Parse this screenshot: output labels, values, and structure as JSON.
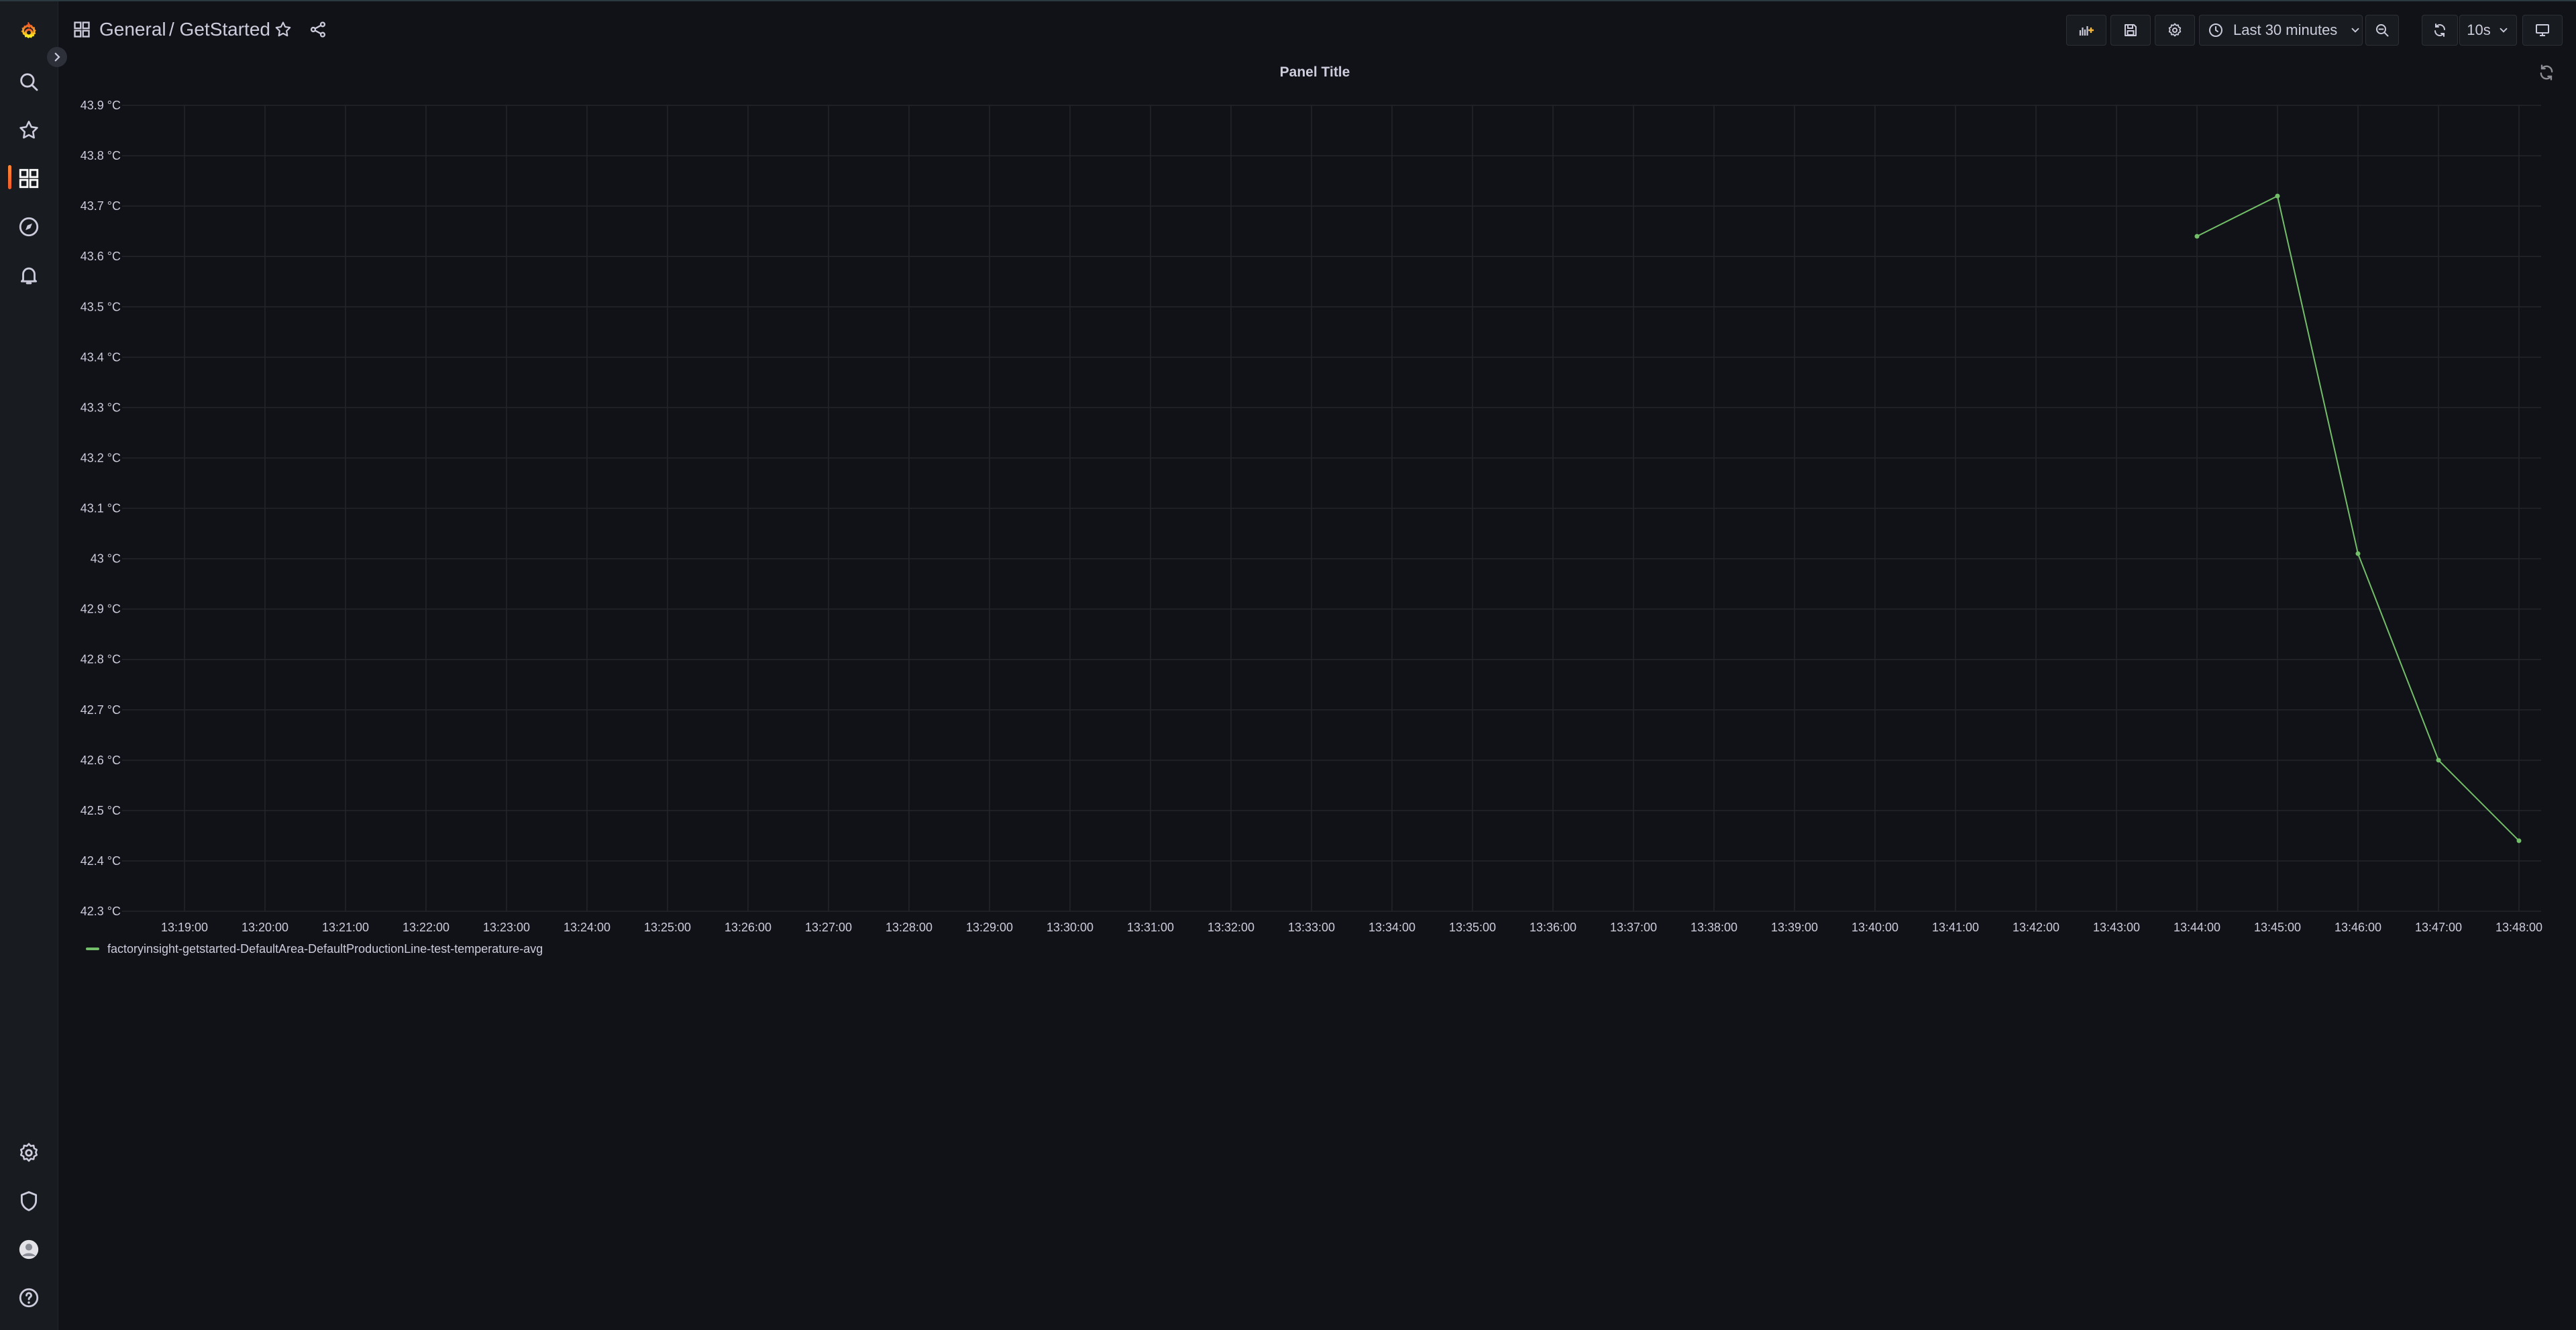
{
  "breadcrumb": {
    "folder": "General",
    "dashboard": "/ GetStarted"
  },
  "toolbar": {
    "time_range": "Last 30 minutes",
    "refresh_interval": "10s"
  },
  "panel": {
    "title": "Panel Title"
  },
  "colors": {
    "series": "#73bf69",
    "accent": "#f05a28",
    "background": "#111217"
  },
  "chart_data": {
    "type": "line",
    "title": "Panel Title",
    "grid": true,
    "legend": "bottom-left",
    "ylim": [
      42.3,
      43.9
    ],
    "y_unit": "°C",
    "y_ticks": [
      "43.9 °C",
      "43.8 °C",
      "43.7 °C",
      "43.6 °C",
      "43.5 °C",
      "43.4 °C",
      "43.3 °C",
      "43.2 °C",
      "43.1 °C",
      "43 °C",
      "42.9 °C",
      "42.8 °C",
      "42.7 °C",
      "42.6 °C",
      "42.5 °C",
      "42.4 °C",
      "42.3 °C"
    ],
    "x_ticks": [
      "13:19:00",
      "13:20:00",
      "13:21:00",
      "13:22:00",
      "13:23:00",
      "13:24:00",
      "13:25:00",
      "13:26:00",
      "13:27:00",
      "13:28:00",
      "13:29:00",
      "13:30:00",
      "13:31:00",
      "13:32:00",
      "13:33:00",
      "13:34:00",
      "13:35:00",
      "13:36:00",
      "13:37:00",
      "13:38:00",
      "13:39:00",
      "13:40:00",
      "13:41:00",
      "13:42:00",
      "13:43:00",
      "13:44:00",
      "13:45:00",
      "13:46:00",
      "13:47:00",
      "13:48:00"
    ],
    "series": [
      {
        "name": "factoryinsight-getstarted-DefaultArea-DefaultProductionLine-test-temperature-avg",
        "x": [
          "13:44:00",
          "13:45:00",
          "13:46:00",
          "13:47:00",
          "13:48:00"
        ],
        "values": [
          43.64,
          43.72,
          43.01,
          42.6,
          42.44
        ]
      }
    ]
  }
}
